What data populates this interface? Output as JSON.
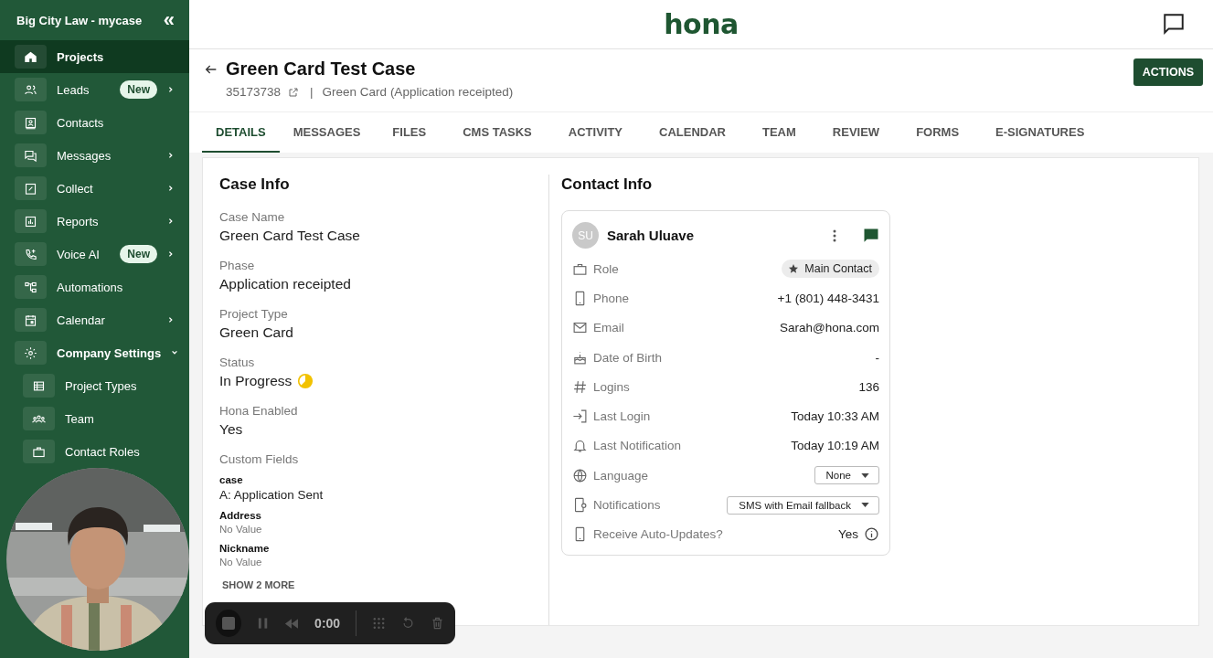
{
  "sidebar": {
    "org": "Big City Law - mycase",
    "collapse_icon": "«",
    "items": [
      {
        "label": "Projects",
        "selected": true,
        "expanded": false,
        "submenu": false
      },
      {
        "label": "Leads",
        "badge": "New",
        "selected": false,
        "expanded": false,
        "submenu": true
      },
      {
        "label": "Contacts",
        "selected": false,
        "expanded": false,
        "submenu": false
      },
      {
        "label": "Messages",
        "selected": false,
        "expanded": false,
        "submenu": true
      },
      {
        "label": "Collect",
        "selected": false,
        "expanded": false,
        "submenu": true
      },
      {
        "label": "Reports",
        "selected": false,
        "expanded": false,
        "submenu": true
      },
      {
        "label": "Voice AI",
        "badge": "New",
        "selected": false,
        "expanded": false,
        "submenu": true
      },
      {
        "label": "Automations",
        "selected": false,
        "expanded": false,
        "submenu": false
      },
      {
        "label": "Calendar",
        "selected": false,
        "expanded": false,
        "submenu": true
      },
      {
        "label": "Company Settings",
        "selected": false,
        "expanded": true,
        "submenu": true,
        "children": [
          {
            "label": "Project Types",
            "selected": false
          },
          {
            "label": "Team",
            "selected": false
          },
          {
            "label": "Contact Roles",
            "selected": false
          }
        ]
      }
    ]
  },
  "topbar": {
    "logo": "hona"
  },
  "header": {
    "title": "Green Card Test Case",
    "case_id": "35173738",
    "separator": "|",
    "subtitle": "Green Card (Application receipted)",
    "action": "ACTIONS"
  },
  "tabs": [
    {
      "label": "DETAILS",
      "selected": true
    },
    {
      "label": "MESSAGES",
      "selected": false
    },
    {
      "label": "FILES",
      "selected": false
    },
    {
      "label": "CMS TASKS",
      "selected": false
    },
    {
      "label": "ACTIVITY",
      "selected": false
    },
    {
      "label": "CALENDAR",
      "selected": false
    },
    {
      "label": "TEAM",
      "selected": false
    },
    {
      "label": "REVIEW",
      "selected": false
    },
    {
      "label": "FORMS",
      "selected": false
    },
    {
      "label": "E-SIGNATURES",
      "selected": false
    }
  ],
  "case_info": {
    "title": "Case Info",
    "fields": [
      {
        "label": "Case Name",
        "value": "Green Card Test Case",
        "kind": "text"
      },
      {
        "label": "Phase",
        "value": "Application receipted",
        "kind": "text"
      },
      {
        "label": "Project Type",
        "value": "Green Card",
        "kind": "text"
      },
      {
        "label": "Status",
        "value": "In Progress",
        "kind": "status"
      },
      {
        "label": "Hona Enabled",
        "value": "Yes",
        "kind": "text"
      }
    ],
    "custom_title": "Custom Fields",
    "custom": [
      {
        "label": "case",
        "value": "A: Application Sent",
        "empty": false
      },
      {
        "label": "Address",
        "value": "No Value",
        "empty": true
      },
      {
        "label": "Nickname",
        "value": "No Value",
        "empty": true
      }
    ],
    "show_more": "SHOW 2 MORE"
  },
  "contact_info": {
    "title": "Contact Info",
    "initials": "SU",
    "name": "Sarah Uluave",
    "rows": [
      {
        "label": "Role",
        "value": "Main Contact",
        "kind": "chip"
      },
      {
        "label": "Phone",
        "value": "+1 (801) 448-3431",
        "kind": "text"
      },
      {
        "label": "Email",
        "value": "Sarah@hona.com",
        "kind": "text"
      },
      {
        "label": "Date of Birth",
        "value": "-",
        "kind": "text"
      },
      {
        "label": "Logins",
        "value": "136",
        "kind": "text"
      },
      {
        "label": "Last Login",
        "value": "Today 10:33 AM",
        "kind": "text"
      },
      {
        "label": "Last Notification",
        "value": "Today 10:19 AM",
        "kind": "text"
      },
      {
        "label": "Language",
        "value": "None",
        "kind": "select"
      },
      {
        "label": "Notifications",
        "value": "SMS with Email fallback",
        "kind": "select"
      },
      {
        "label": "Receive Auto-Updates?",
        "value": "Yes",
        "kind": "info"
      }
    ]
  },
  "recorder": {
    "time": "0:00"
  }
}
